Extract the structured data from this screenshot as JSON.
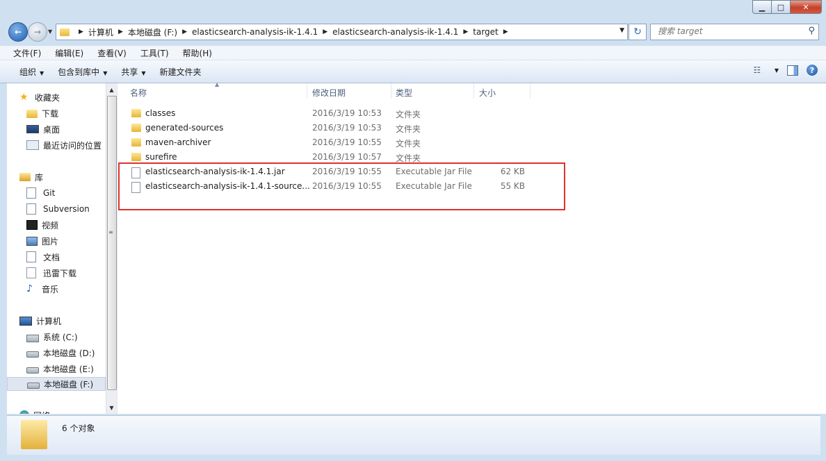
{
  "window": {
    "minimize_glyph": "▁",
    "maximize_glyph": "□",
    "close_glyph": "✕"
  },
  "address": {
    "crumbs": [
      "计算机",
      "本地磁盘 (F:)",
      "elasticsearch-analysis-ik-1.4.1",
      "elasticsearch-analysis-ik-1.4.1",
      "target"
    ],
    "search_placeholder": "搜索 target"
  },
  "menu": [
    "文件(F)",
    "编辑(E)",
    "查看(V)",
    "工具(T)",
    "帮助(H)"
  ],
  "toolbar": {
    "organize": "组织",
    "include_library": "包含到库中",
    "share": "共享",
    "new_folder": "新建文件夹"
  },
  "nav": {
    "favorites": {
      "label": "收藏夹",
      "items": [
        "下载",
        "桌面",
        "最近访问的位置"
      ]
    },
    "libraries": {
      "label": "库",
      "items": [
        "Git",
        "Subversion",
        "视频",
        "图片",
        "文档",
        "迅雷下载",
        "音乐"
      ]
    },
    "computer": {
      "label": "计算机",
      "items": [
        "系统 (C:)",
        "本地磁盘 (D:)",
        "本地磁盘 (E:)",
        "本地磁盘 (F:)"
      ],
      "selected": "本地磁盘 (F:)"
    },
    "network": {
      "label": "网络"
    }
  },
  "columns": {
    "name": "名称",
    "modified": "修改日期",
    "type": "类型",
    "size": "大小"
  },
  "files": [
    {
      "name": "classes",
      "modified": "2016/3/19 10:53",
      "type": "文件夹",
      "size": "",
      "kind": "folder"
    },
    {
      "name": "generated-sources",
      "modified": "2016/3/19 10:53",
      "type": "文件夹",
      "size": "",
      "kind": "folder"
    },
    {
      "name": "maven-archiver",
      "modified": "2016/3/19 10:55",
      "type": "文件夹",
      "size": "",
      "kind": "folder"
    },
    {
      "name": "surefire",
      "modified": "2016/3/19 10:57",
      "type": "文件夹",
      "size": "",
      "kind": "folder"
    },
    {
      "name": "elasticsearch-analysis-ik-1.4.1.jar",
      "modified": "2016/3/19 10:55",
      "type": "Executable Jar File",
      "size": "62 KB",
      "kind": "jar"
    },
    {
      "name": "elasticsearch-analysis-ik-1.4.1-source...",
      "modified": "2016/3/19 10:55",
      "type": "Executable Jar File",
      "size": "55 KB",
      "kind": "jar"
    }
  ],
  "status": {
    "count": "6 个对象"
  },
  "colors": {
    "highlight_border": "#e0302c",
    "frame": "#cfe0f1"
  }
}
